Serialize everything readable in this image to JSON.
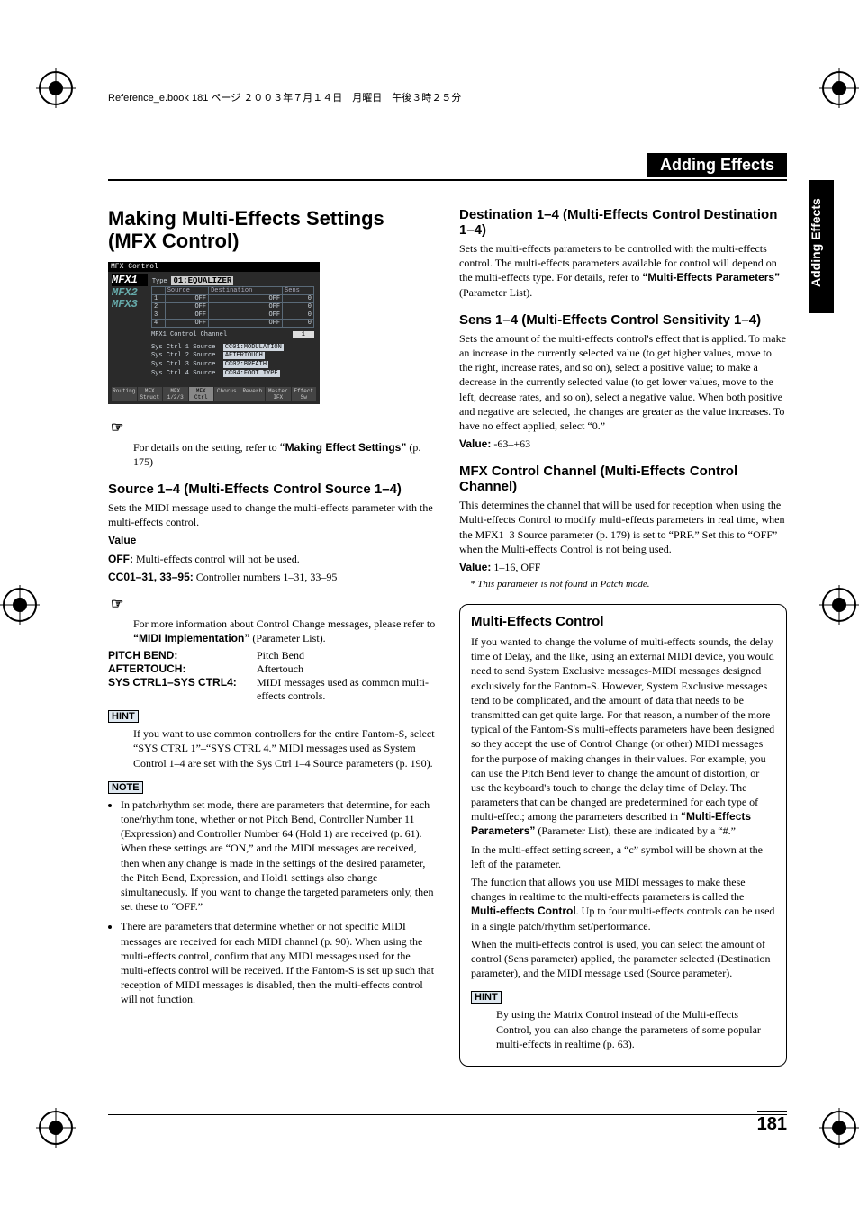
{
  "meta_line": "Reference_e.book 181 ページ ２００３年７月１４日　月曜日　午後３時２５分",
  "header_title": "Adding Effects",
  "side_tab": "Adding Effects",
  "page_number": "181",
  "left": {
    "h1": "Making Multi-Effects Settings (MFX Control)",
    "screenshot": {
      "titlebar": "MFX Control",
      "tabs": [
        "MFX1",
        "MFX2",
        "MFX3"
      ],
      "type_label": "Type",
      "type_value": "01:EQUALIZER",
      "table_headers": [
        "",
        "Source",
        "Destination",
        "Sens"
      ],
      "table_rows": [
        [
          "1",
          "OFF",
          "OFF",
          "0"
        ],
        [
          "2",
          "OFF",
          "OFF",
          "0"
        ],
        [
          "3",
          "OFF",
          "OFF",
          "0"
        ],
        [
          "4",
          "OFF",
          "OFF",
          "0"
        ]
      ],
      "channel_label": "MFX1 Control Channel",
      "channel_value": "1",
      "src_rows": [
        {
          "label": "Sys Ctrl 1 Source",
          "value": "CC01:MODULATION"
        },
        {
          "label": "Sys Ctrl 2 Source",
          "value": "AFTERTOUCH"
        },
        {
          "label": "Sys Ctrl 3 Source",
          "value": "CC02:BREATH"
        },
        {
          "label": "Sys Ctrl 4 Source",
          "value": "CC04:FOOT TYPE"
        }
      ],
      "buttons": [
        "Routing",
        "MFX Struct",
        "MFX 1/2/3",
        "MFX Ctrl",
        "Chorus",
        "Reverb",
        "Master IFX",
        "Effect Sw"
      ]
    },
    "ref_intro": "For details on the setting, refer to ",
    "ref_link": "“Making Effect Settings”",
    "ref_page": " (p. 175)",
    "source_h2": "Source 1–4 (Multi-Effects Control Source 1–4)",
    "source_p": "Sets the MIDI message used to change the multi-effects parameter with the multi-effects control.",
    "value_label": "Value",
    "off_label": "OFF:",
    "off_text": " Multi-effects control will not be used.",
    "cc_label": "CC01–31, 33–95:",
    "cc_text": " Controller numbers 1–31, 33–95",
    "more_info_pre": "For more information about Control Change messages, please refer to ",
    "more_info_link": "“MIDI Implementation”",
    "more_info_post": " (Parameter List).",
    "rows": [
      {
        "k": "PITCH BEND:",
        "v": "Pitch Bend"
      },
      {
        "k": "AFTERTOUCH:",
        "v": "Aftertouch"
      },
      {
        "k": "SYS CTRL1–SYS CTRL4:",
        "v": "MIDI messages used as common multi-effects controls."
      }
    ],
    "hint": "If you want to use common controllers for the entire Fantom-S, select “SYS CTRL 1”–“SYS CTRL 4.” MIDI messages used as System Control 1–4 are set with the Sys Ctrl 1–4 Source parameters (p. 190).",
    "notes": [
      "In patch/rhythm set mode, there are parameters that determine, for each tone/rhythm tone, whether or not Pitch Bend, Controller Number 11 (Expression) and Controller Number 64 (Hold 1) are received (p. 61). When these settings are “ON,” and the MIDI messages are received, then when any change is made in the settings of the desired parameter, the Pitch Bend, Expression, and Hold1 settings also change simultaneously. If you want to change the targeted parameters only, then set these to “OFF.”",
      "There are parameters that determine whether or not specific MIDI messages are received for each MIDI channel (p. 90). When using the multi-effects control, confirm that any MIDI messages used for the multi-effects control will be received. If the Fantom-S is set up such that reception of MIDI messages is disabled, then the multi-effects control will not function."
    ]
  },
  "right": {
    "dest_h2": "Destination 1–4 (Multi-Effects Control Destination 1–4)",
    "dest_p_pre": "Sets the multi-effects parameters to be controlled with the multi-effects control. The multi-effects parameters available for control will depend on the multi-effects type. For details, refer to ",
    "dest_link": "“Multi-Effects Parameters”",
    "dest_p_post": " (Parameter List).",
    "sens_h2": "Sens 1–4 (Multi-Effects Control Sensitivity 1–4)",
    "sens_p": "Sets the amount of the multi-effects control's effect that is applied. To make an increase in the currently selected value (to get higher values, move to the right, increase rates, and so on), select a positive value; to make a decrease in the currently selected value (to get lower values, move to the left, decrease rates, and so on), select a negative value. When both positive and negative are selected, the changes are greater as the value increases. To have no effect applied, select “0.”",
    "sens_value_label": "Value:",
    "sens_value": " -63–+63",
    "chan_h2": "MFX Control Channel (Multi-Effects Control Channel)",
    "chan_p": "This determines the channel that will be used for reception when using the Multi-effects Control to modify multi-effects parameters in real time, when the MFX1–3 Source parameter (p. 179) is set to “PRF.” Set this to “OFF” when the Multi-effects Control is not being used.",
    "chan_value_label": "Value:",
    "chan_value": " 1–16, OFF",
    "chan_note": "*  This parameter is not found in Patch mode.",
    "box_h2": "Multi-Effects Control",
    "box_p1_pre": "If you wanted to change the volume of multi-effects sounds, the delay time of Delay, and the like, using an external MIDI device, you would need to send System Exclusive messages-MIDI messages designed exclusively for the Fantom-S. However, System Exclusive messages tend to be complicated, and the amount of data that needs to be transmitted can get quite large. For that reason, a number of the more typical of the Fantom-S's multi-effects parameters have been designed so they accept the use of Control Change (or other) MIDI messages for the purpose of making changes in their values. For example, you can use the Pitch Bend lever to change the amount of distortion, or use the keyboard's touch to change the delay time of Delay. The parameters that can be changed are predetermined for each type of multi-effect; among the parameters described in ",
    "box_link": "“Multi-Effects Parameters”",
    "box_p1_post": " (Parameter List), these are indicated by a “#.”",
    "box_p2": "In the multi-effect setting screen, a “c” symbol will be shown at the left of the parameter.",
    "box_p3_pre": "The function that allows you use MIDI messages to make these changes in realtime to the multi-effects parameters is called the ",
    "box_p3_b": "Multi-effects Control",
    "box_p3_post": ". Up to four multi-effects controls can be used in a single patch/rhythm set/performance.",
    "box_p4": "When the multi-effects control is used, you can select the amount of control (Sens parameter) applied, the parameter selected (Destination parameter), and the MIDI message used (Source parameter).",
    "box_hint": "By using the Matrix Control instead of the Multi-effects Control, you can also change the parameters of some popular multi-effects in realtime (p. 63)."
  }
}
